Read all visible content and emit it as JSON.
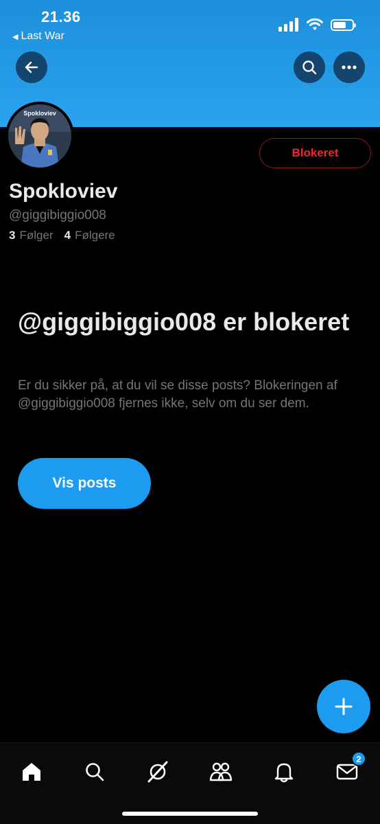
{
  "status_bar": {
    "time": "21.36",
    "back_app": "Last War",
    "battery_level": 0.7
  },
  "header": {
    "back_icon": "arrow-left-icon",
    "search_icon": "search-icon",
    "more_icon": "ellipsis-icon"
  },
  "profile": {
    "avatar_caption": "Spokloviev",
    "display_name": "Spokloviev",
    "handle": "@giggibiggio008",
    "following_count": "3",
    "following_label": "Følger",
    "followers_count": "4",
    "followers_label": "Følgere",
    "blocked_button_label": "Blokeret"
  },
  "blocked_notice": {
    "title": "@giggibiggio008 er blokeret",
    "description": "Er du sikker på, at du vil se disse posts? Blokeringen af @giggibiggio008 fjernes ikke, selv om du ser dem.",
    "show_posts_label": "Vis posts"
  },
  "fab": {
    "icon": "plus-icon"
  },
  "tabbar": {
    "items": [
      {
        "name": "home",
        "icon": "home-icon"
      },
      {
        "name": "search",
        "icon": "search-icon"
      },
      {
        "name": "grok",
        "icon": "grok-icon"
      },
      {
        "name": "communities",
        "icon": "people-icon"
      },
      {
        "name": "notifications",
        "icon": "bell-icon"
      },
      {
        "name": "messages",
        "icon": "mail-icon",
        "badge": "2"
      }
    ]
  },
  "colors": {
    "accent": "#1d9bf0",
    "blocked_red": "#f4212e",
    "background": "#000000",
    "muted_text": "#71767b"
  }
}
